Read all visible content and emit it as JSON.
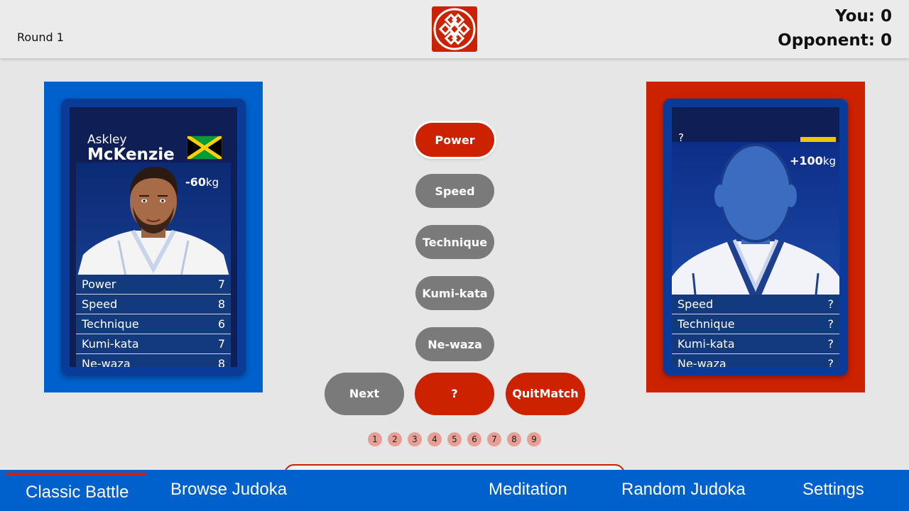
{
  "header": {
    "round": "Round 1",
    "score_you": "You: 0",
    "score_opponent": "Opponent: 0",
    "logo_icon": "knot-logo-icon"
  },
  "player_card": {
    "first_name": "Askley",
    "last_name": "McKenzie",
    "flag": "jamaica-flag",
    "weight_value": "-60",
    "weight_unit": "kg",
    "stats": [
      {
        "label": "Power",
        "value": "7"
      },
      {
        "label": "Speed",
        "value": "8"
      },
      {
        "label": "Technique",
        "value": "6"
      },
      {
        "label": "Kumi-kata",
        "value": "7"
      },
      {
        "label": "Ne-waza",
        "value": "8"
      }
    ]
  },
  "opponent_card": {
    "name": "?",
    "weight_value": "+100",
    "weight_unit": "kg",
    "stats": [
      {
        "label": "Speed",
        "value": "?"
      },
      {
        "label": "Technique",
        "value": "?"
      },
      {
        "label": "Kumi-kata",
        "value": "?"
      },
      {
        "label": "Ne-waza",
        "value": "?"
      }
    ]
  },
  "stat_buttons": [
    "Power",
    "Speed",
    "Technique",
    "Kumi-kata",
    "Ne-waza"
  ],
  "controls": {
    "next": "Next",
    "mystery": "?",
    "quit_line1": "Quit",
    "quit_line2": "Match"
  },
  "rounds": [
    "1",
    "2",
    "3",
    "4",
    "5",
    "6",
    "7",
    "8",
    "9"
  ],
  "nav": {
    "classic_battle": "Classic Battle",
    "browse_judoka": "Browse Judoka",
    "meditation": "Meditation",
    "random_judoka": "Random Judoka",
    "settings": "Settings"
  },
  "colors": {
    "accent_red": "#cc2200",
    "nav_blue": "#0060cc",
    "button_gray": "#7a7a7a"
  }
}
